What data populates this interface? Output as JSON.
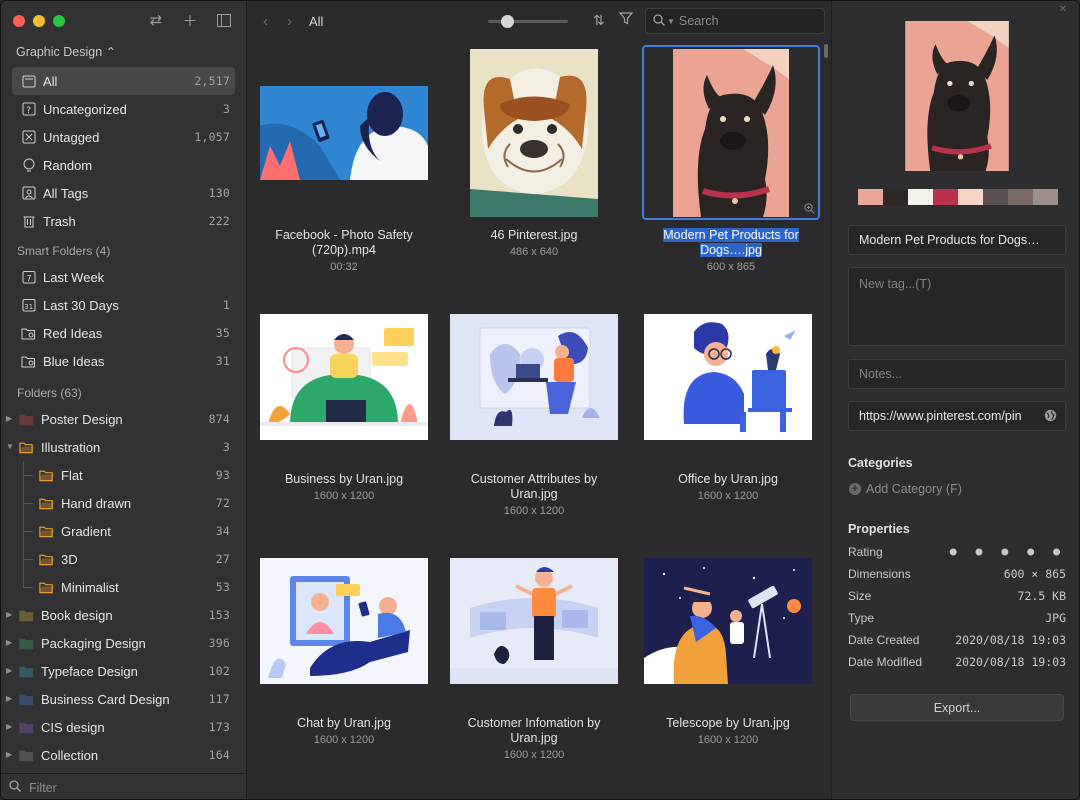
{
  "library": {
    "name": "Graphic Design ⌃"
  },
  "sidebar": {
    "main": [
      {
        "label": "All",
        "count": "2,517"
      },
      {
        "label": "Uncategorized",
        "count": "3"
      },
      {
        "label": "Untagged",
        "count": "1,057"
      },
      {
        "label": "Random",
        "count": ""
      },
      {
        "label": "All Tags",
        "count": "130"
      },
      {
        "label": "Trash",
        "count": "222"
      }
    ],
    "smart_title": "Smart Folders (4)",
    "smart": [
      {
        "label": "Last Week",
        "count": ""
      },
      {
        "label": "Last 30 Days",
        "count": "1"
      },
      {
        "label": "Red Ideas",
        "count": "35"
      },
      {
        "label": "Blue Ideas",
        "count": "31"
      }
    ],
    "folders_title": "Folders (63)",
    "folders": [
      {
        "label": "Poster Design",
        "count": "874",
        "color": "#e0514a"
      },
      {
        "label": "Illustration",
        "count": "3",
        "color": "#e89a2c"
      },
      {
        "label": "Flat",
        "count": "93",
        "color": "#e89a2c"
      },
      {
        "label": "Hand drawn",
        "count": "72",
        "color": "#e89a2c"
      },
      {
        "label": "Gradient",
        "count": "34",
        "color": "#e89a2c"
      },
      {
        "label": "3D",
        "count": "27",
        "color": "#e89a2c"
      },
      {
        "label": "Minimalist",
        "count": "53",
        "color": "#e89a2c"
      },
      {
        "label": "Book design",
        "count": "153",
        "color": "#e9c12f"
      },
      {
        "label": "Packaging Design",
        "count": "396",
        "color": "#3fbf6a"
      },
      {
        "label": "Typeface Design",
        "count": "102",
        "color": "#2fb7c9"
      },
      {
        "label": "Business Card Design",
        "count": "117",
        "color": "#4a8fe0"
      },
      {
        "label": "CIS design",
        "count": "173",
        "color": "#9b6be0"
      },
      {
        "label": "Collection",
        "count": "164",
        "color": "#9a9a9c"
      }
    ],
    "filter_placeholder": "Filter"
  },
  "toolbar": {
    "breadcrumb": "All",
    "search_placeholder": "Search"
  },
  "items": [
    {
      "name": "Facebook - Photo Safety (720p).mp4",
      "meta": "00:32"
    },
    {
      "name": "46 Pinterest.jpg",
      "meta": "486 x 640"
    },
    {
      "name": "Modern Pet Products for Dogs….jpg",
      "meta": "600 x 865"
    },
    {
      "name": "Business by Uran.jpg",
      "meta": "1600 x 1200"
    },
    {
      "name": "Customer Attributes by Uran.jpg",
      "meta": "1600 x 1200"
    },
    {
      "name": "Office by Uran.jpg",
      "meta": "1600 x 1200"
    },
    {
      "name": "Chat by Uran.jpg",
      "meta": "1600 x 1200"
    },
    {
      "name": "Customer Infomation by Uran.jpg",
      "meta": "1600 x 1200"
    },
    {
      "name": "Telescope by Uran.jpg",
      "meta": "1600 x 1200"
    }
  ],
  "inspector": {
    "palette": [
      "#e8a59a",
      "#2e2726",
      "#f4f0ec",
      "#b7324a",
      "#f5d3c5",
      "#5b5050",
      "#7a6a66",
      "#9b8f8b"
    ],
    "name_value": "Modern Pet Products for Dogs…",
    "tag_placeholder": "New tag...(T)",
    "notes_placeholder": "Notes...",
    "url_value": "https://www.pinterest.com/pin",
    "categories_title": "Categories",
    "add_category": "Add Category (F)",
    "properties_title": "Properties",
    "properties": [
      {
        "key": "Rating",
        "value": "● ● ● ● ●"
      },
      {
        "key": "Dimensions",
        "value": "600 × 865"
      },
      {
        "key": "Size",
        "value": "72.5 KB"
      },
      {
        "key": "Type",
        "value": "JPG"
      },
      {
        "key": "Date Created",
        "value": "2020/08/18 19:03"
      },
      {
        "key": "Date Modified",
        "value": "2020/08/18 19:03"
      }
    ],
    "export_label": "Export..."
  }
}
